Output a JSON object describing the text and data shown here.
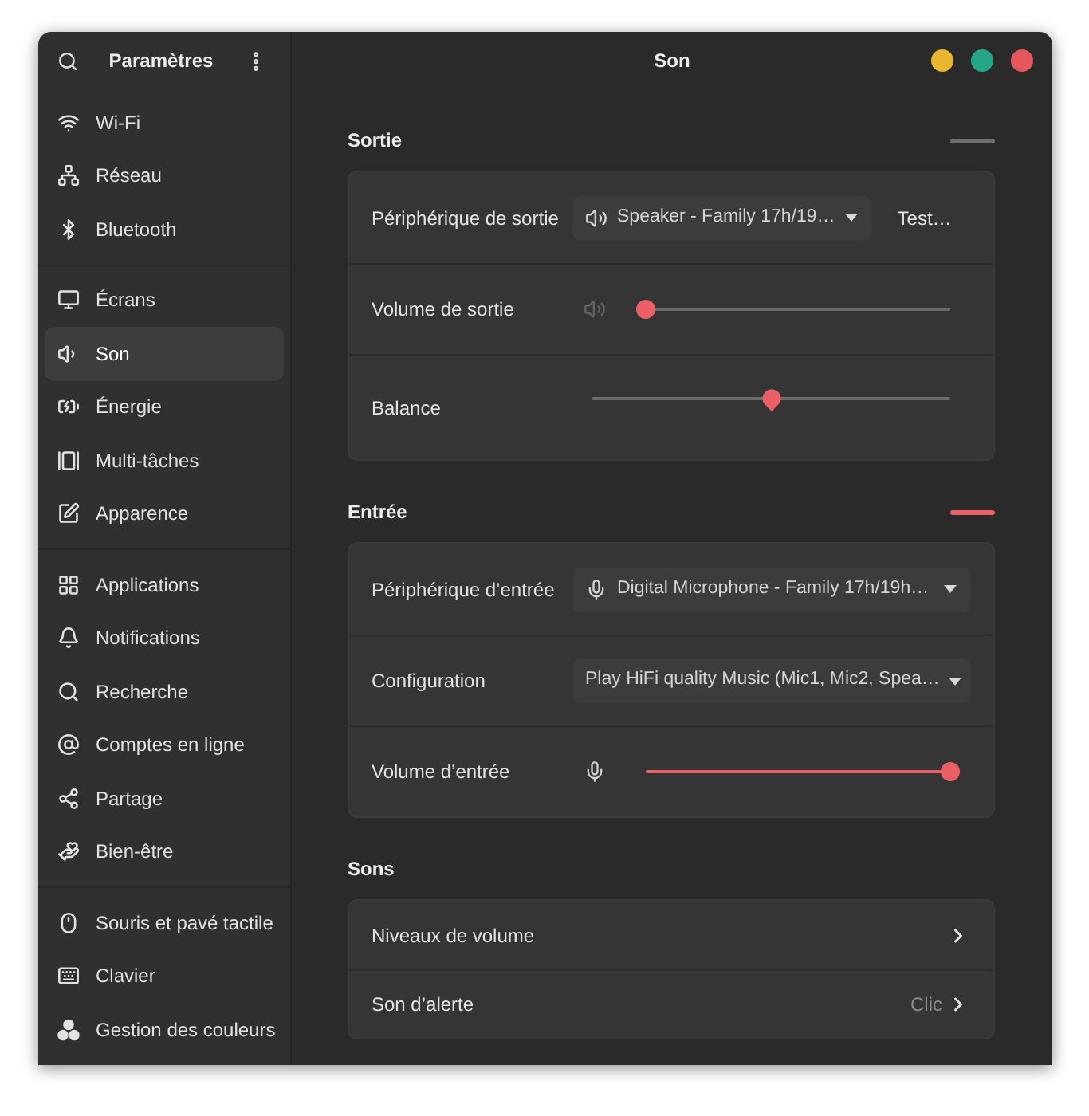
{
  "window": {
    "title": "Son"
  },
  "sidebar": {
    "title": "Paramètres",
    "groups": [
      {
        "items": [
          {
            "label": "Wi-Fi",
            "selected": false
          },
          {
            "label": "Réseau",
            "selected": false
          },
          {
            "label": "Bluetooth",
            "selected": false
          }
        ]
      },
      {
        "items": [
          {
            "label": "Écrans",
            "selected": false
          },
          {
            "label": "Son",
            "selected": true
          },
          {
            "label": "Énergie",
            "selected": false
          },
          {
            "label": "Multi-tâches",
            "selected": false
          },
          {
            "label": "Apparence",
            "selected": false
          }
        ]
      },
      {
        "items": [
          {
            "label": "Applications",
            "selected": false
          },
          {
            "label": "Notifications",
            "selected": false
          },
          {
            "label": "Recherche",
            "selected": false
          },
          {
            "label": "Comptes en ligne",
            "selected": false
          },
          {
            "label": "Partage",
            "selected": false
          },
          {
            "label": "Bien-être",
            "selected": false
          }
        ]
      },
      {
        "items": [
          {
            "label": "Souris et pavé tactile",
            "selected": false
          },
          {
            "label": "Clavier",
            "selected": false
          },
          {
            "label": "Gestion des couleurs",
            "selected": false
          }
        ]
      }
    ]
  },
  "sections": [
    {
      "title": "Sortie",
      "meter": {
        "active": false
      },
      "rows": [
        {
          "kind": "device",
          "label": "Périphérique de sortie",
          "value": "Speaker - Family 17h/19…",
          "button": "Test…"
        },
        {
          "kind": "volume",
          "label": "Volume de sortie",
          "muted": true,
          "level": 0
        },
        {
          "kind": "balance",
          "label": "Balance",
          "level": 0.5
        }
      ]
    },
    {
      "title": "Entrée",
      "meter": {
        "active": true
      },
      "rows": [
        {
          "kind": "device",
          "label": "Périphérique d’entrée",
          "value": "Digital Microphone - Family 17h/19h…"
        },
        {
          "kind": "select",
          "label": "Configuration",
          "value": "Play HiFi quality Music (Mic1, Mic2, Spea…"
        },
        {
          "kind": "volume",
          "label": "Volume d’entrée",
          "muted": false,
          "level": 1
        }
      ]
    },
    {
      "title": "Sons",
      "rows": [
        {
          "kind": "link",
          "label": "Niveaux de volume"
        },
        {
          "kind": "link",
          "label": "Son d’alerte",
          "value": "Clic"
        }
      ]
    }
  ]
}
